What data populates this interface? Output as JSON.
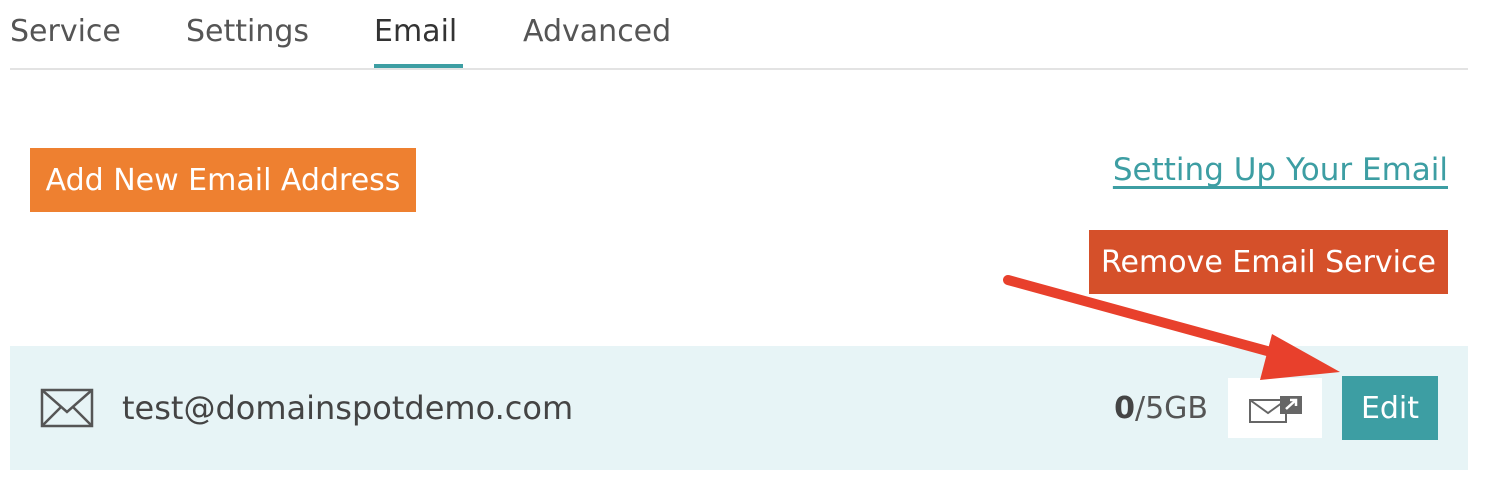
{
  "tabs": [
    {
      "label": "Service"
    },
    {
      "label": "Settings"
    },
    {
      "label": "Email",
      "active": true
    },
    {
      "label": "Advanced"
    }
  ],
  "actions": {
    "add_label": "Add New Email Address",
    "help_link": "Setting Up Your Email",
    "remove_label": "Remove Email Service"
  },
  "email_row": {
    "address": "test@domainspotdemo.com",
    "usage_used": "0",
    "usage_total": "/5GB",
    "edit_label": "Edit"
  },
  "colors": {
    "accent": "#3d9ea3",
    "add_button": "#ee8030",
    "remove_button": "#d5502a",
    "annotation_arrow": "#e8402c",
    "row_background": "#e7f4f6"
  },
  "icons": {
    "row_icon": "envelope-icon",
    "webmail_icon": "envelope-external-link-icon"
  }
}
